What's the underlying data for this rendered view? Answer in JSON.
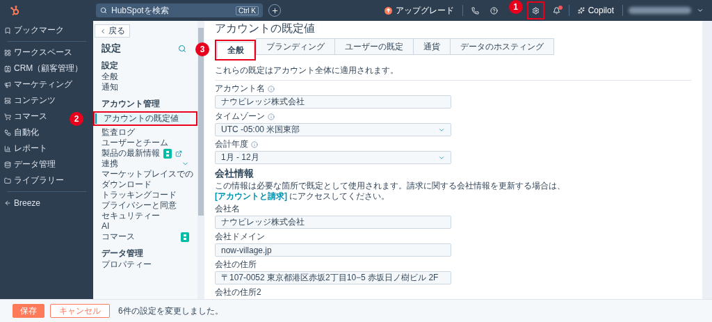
{
  "top_bar": {
    "search": {
      "placeholder": "HubSpotを検索",
      "shortcut": "Ctrl K"
    },
    "upgrade": "アップグレード",
    "settings_callout": "1",
    "copilot": "Copilot"
  },
  "nav": {
    "groups": [
      [
        {
          "label": "ブックマーク"
        }
      ],
      [
        {
          "label": "ワークスペース"
        },
        {
          "label": "CRM（顧客管理）"
        },
        {
          "label": "マーケティング"
        },
        {
          "label": "コンテンツ"
        },
        {
          "label": "コマース"
        },
        {
          "label": "自動化"
        },
        {
          "label": "レポート"
        },
        {
          "label": "データ管理"
        },
        {
          "label": "ライブラリー"
        }
      ],
      [
        {
          "label": "Breeze"
        }
      ]
    ]
  },
  "settings_sidebar": {
    "back": "戻る",
    "title": "設定",
    "sections": [
      {
        "heading": "設定",
        "items": [
          {
            "label": "全般",
            "kind": "plain",
            "selected": false
          },
          {
            "label": "通知",
            "kind": "plain",
            "selected": false
          }
        ]
      },
      {
        "heading": "アカウント管理",
        "items": [
          {
            "label": "アカウントの既定値",
            "kind": "plain",
            "selected": true,
            "callout": "2"
          },
          {
            "label": "監査ログ",
            "kind": "plain",
            "selected": false
          },
          {
            "label": "ユーザーとチーム",
            "kind": "plain",
            "selected": false
          },
          {
            "label": "製品の最新情報",
            "kind": "badged-external",
            "selected": false
          },
          {
            "label": "連携",
            "kind": "expander",
            "selected": false,
            "expanded": false
          },
          {
            "label": "マーケットプレイスでのダウンロード",
            "kind": "plain",
            "selected": false
          },
          {
            "label": "トラッキングコード",
            "kind": "plain",
            "selected": false
          },
          {
            "label": "プライバシーと同意",
            "kind": "plain",
            "selected": false
          },
          {
            "label": "セキュリティー",
            "kind": "plain",
            "selected": false
          },
          {
            "label": "AI",
            "kind": "plain",
            "selected": false
          },
          {
            "label": "コマース",
            "kind": "badged",
            "selected": false
          }
        ]
      },
      {
        "heading": "データ管理",
        "items": [
          {
            "label": "プロパティー",
            "kind": "plain",
            "selected": false
          }
        ]
      }
    ]
  },
  "main": {
    "title": "アカウントの既定値",
    "tabs": [
      {
        "label": "全般",
        "selected": true,
        "callout": "3"
      },
      {
        "label": "ブランディング",
        "selected": false
      },
      {
        "label": "ユーザーの既定",
        "selected": false
      },
      {
        "label": "通貨",
        "selected": false
      },
      {
        "label": "データのホスティング",
        "selected": false
      }
    ],
    "description": "これらの既定はアカウント全体に適用されます。",
    "fields": [
      {
        "label": "アカウント名",
        "info": true,
        "kind": "text",
        "value": "ナウビレッジ株式会社"
      },
      {
        "label": "タイムゾーン",
        "info": true,
        "kind": "select",
        "value": "UTC -05:00 米国東部"
      },
      {
        "label": "会計年度",
        "info": true,
        "kind": "select",
        "value": "1月 - 12月"
      }
    ],
    "company": {
      "heading": "会社情報",
      "description_before": "この情報は必要な箇所で既定として使用されます。請求に関する会社情報を更新する場合は、",
      "link": "[アカウントと請求]",
      "description_after": " にアクセスしてください。",
      "fields": [
        {
          "label": "会社名",
          "info": false,
          "kind": "text",
          "value": "ナウビレッジ株式会社"
        },
        {
          "label": "会社ドメイン",
          "info": false,
          "kind": "text",
          "value": "now-village.jp"
        },
        {
          "label": "会社の住所",
          "info": false,
          "kind": "text",
          "value": "〒107-0052 東京都港区赤坂2丁目10−5 赤坂日ノ樹ビル 2F"
        },
        {
          "label": "会社の住所2",
          "info": false,
          "kind": "label"
        }
      ]
    }
  },
  "footer": {
    "save": "保存",
    "cancel": "キャンセル",
    "status": "6件の設定を変更しました。"
  }
}
